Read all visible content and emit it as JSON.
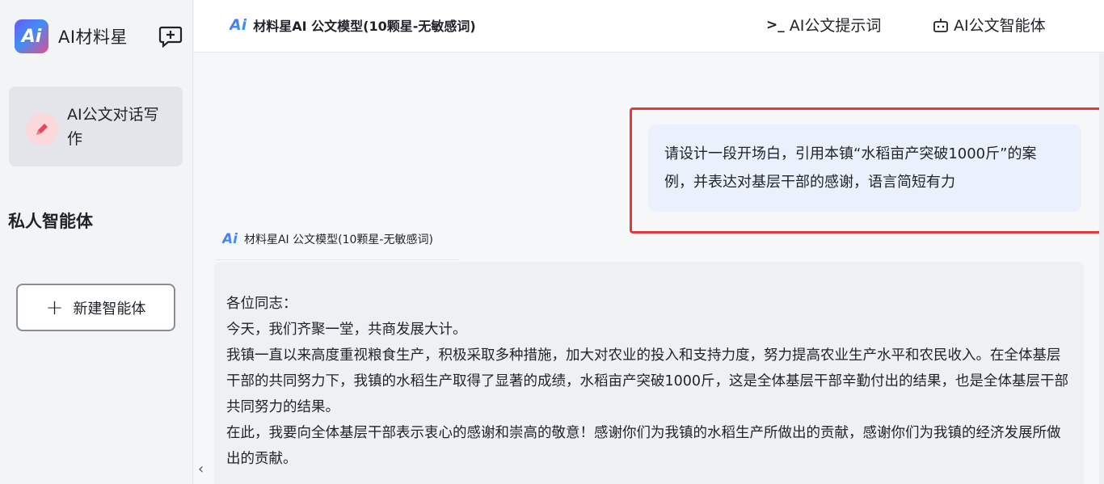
{
  "app": {
    "logo_text": "Ai",
    "name": "AI材料星"
  },
  "sidebar": {
    "active_item": {
      "label": "AI公文对话写作"
    },
    "section_title": "私人智能体",
    "new_agent_label": "新建智能体",
    "new_agent_plus": "+"
  },
  "header": {
    "model_logo": "Ai",
    "model_name": "材料星AI 公文模型(10颗星-无敏感词)",
    "prompt_link": "AI公文提示词",
    "prompt_glyph": ">_",
    "agent_link": "AI公文智能体"
  },
  "chat": {
    "user_message": "请设计一段开场白，引用本镇“水稻亩产突破1000斤”的案例，并表达对基层干部的感谢，语言简短有力",
    "ai_tag_logo": "Ai",
    "ai_tag": "材料星AI 公文模型(10颗星-无敏感词)",
    "answer_paragraphs": [
      "各位同志：",
      "今天，我们齐聚一堂，共商发展大计。",
      "我镇一直以来高度重视粮食生产，积极采取多种措施，加大对农业的投入和支持力度，努力提高农业生产水平和农民收入。在全体基层干部的共同努力下，我镇的水稻生产取得了显著的成绩，水稻亩产突破1000斤，这是全体基层干部辛勤付出的结果，也是全体基层干部共同努力的结果。",
      "在此，我要向全体基层干部表示衷心的感谢和崇高的敬意！感谢你们为我镇的水稻生产所做出的贡献，感谢你们为我镇的经济发展所做出的贡献。"
    ],
    "collapse_glyph": "‹"
  },
  "colors": {
    "highlight_border": "#e53935",
    "user_bubble_bg": "#eaf1fd",
    "active_nav_bg": "#e4e5ea"
  }
}
